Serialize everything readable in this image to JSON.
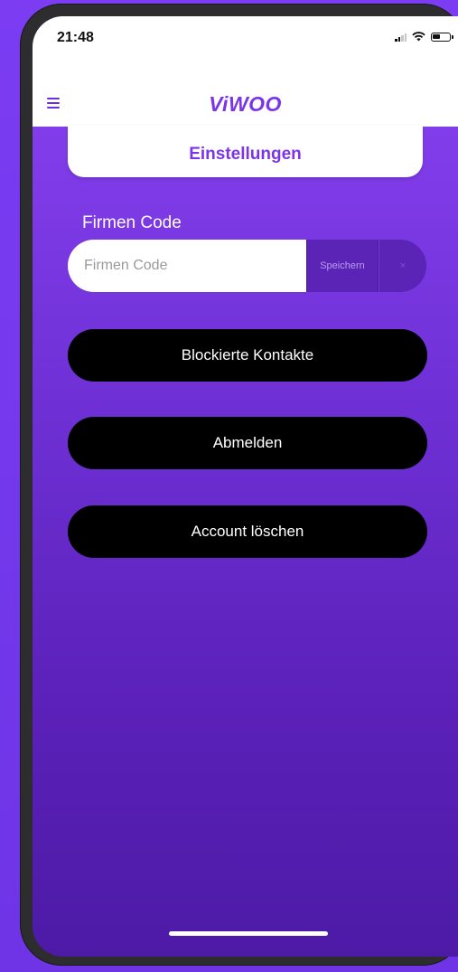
{
  "status_bar": {
    "time": "21:48",
    "icons": [
      "cellular-signal-icon",
      "wifi-icon",
      "battery-icon"
    ]
  },
  "nav": {
    "menu_icon": "hamburger-menu-icon",
    "logo": "ViWOO"
  },
  "page": {
    "title": "Einstellungen"
  },
  "company_code": {
    "label": "Firmen Code",
    "placeholder": "Firmen Code",
    "value": "",
    "save_label": "Speichern",
    "clear_icon": "close-icon",
    "clear_symbol": "×"
  },
  "actions": {
    "blocked_contacts": "Blockierte Kontakte",
    "logout": "Abmelden",
    "delete_account": "Account löschen"
  },
  "colors": {
    "accent": "#7b35e8",
    "background_top": "#8a42f4",
    "background_bottom": "#4d1aa6",
    "button": "#000000",
    "segment": "#5b23b6"
  }
}
